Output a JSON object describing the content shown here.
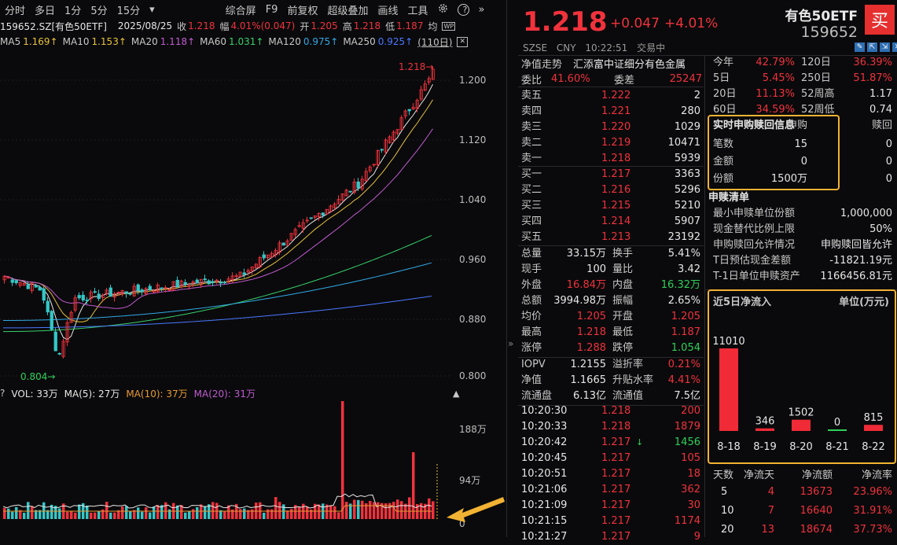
{
  "toolbar": {
    "tabs": [
      "分时",
      "多日",
      "1分",
      "5分",
      "15分"
    ],
    "dropdown_icon": "▾",
    "right": [
      "综合屏",
      "F9",
      "前复权",
      "超级叠加",
      "画线",
      "工具"
    ],
    "settings_icon": "gear-icon",
    "help_icon": "?",
    "more_icon": "»"
  },
  "info": {
    "code": "159652.SZ[有色50ETF]",
    "date": "2025/08/25",
    "close_label": "收",
    "close": "1.218",
    "range_label": "幅",
    "range": "4.01%(0.047)",
    "open_label": "开",
    "open": "1.205",
    "high_label": "高",
    "high": "1.218",
    "low_label": "低",
    "low": "1.187",
    "avg_label": "均"
  },
  "ma": {
    "ma5": "MA5",
    "ma5_v": "1.169↑",
    "ma10": "MA10",
    "ma10_v": "1.153↑",
    "ma20": "MA20",
    "ma20_v": "1.118↑",
    "ma60": "MA60",
    "ma60_v": "1.031↑",
    "ma120": "MA120",
    "ma120_v": "0.975↑",
    "ma250": "MA250",
    "ma250_v": "0.925↑",
    "period": "(110日)"
  },
  "chart": {
    "yticks": [
      "1.200",
      "1.120",
      "1.040",
      "0.960",
      "0.880",
      "0.800"
    ],
    "high_mark": "1.218→",
    "low_mark": "0.804→"
  },
  "vol": {
    "q": "?",
    "vol": "VOL: 33万",
    "ma5": "MA(5): 27万",
    "ma10": "MA(10): 37万",
    "ma20": "MA(20): 31万",
    "yticks": [
      "188万",
      "94万",
      "0"
    ]
  },
  "quote": {
    "price": "1.218",
    "change": "+0.047",
    "pct": "+4.01%",
    "name": "有色50ETF",
    "code": "159652",
    "buy": "买",
    "exch": "SZSE",
    "cur": "CNY",
    "time": "10:22:51",
    "status": "交易中"
  },
  "nav": {
    "label": "净值走势",
    "text": "汇添富中证细分有色金属"
  },
  "wb": {
    "l1": "委比",
    "v1": "41.60%",
    "l2": "委差",
    "v2": "25247"
  },
  "asks": [
    {
      "l": "卖五",
      "p": "1.222",
      "v": "2"
    },
    {
      "l": "卖四",
      "p": "1.221",
      "v": "280"
    },
    {
      "l": "卖三",
      "p": "1.220",
      "v": "1029"
    },
    {
      "l": "卖二",
      "p": "1.219",
      "v": "10471"
    },
    {
      "l": "卖一",
      "p": "1.218",
      "v": "5939"
    }
  ],
  "bids": [
    {
      "l": "买一",
      "p": "1.217",
      "v": "3363"
    },
    {
      "l": "买二",
      "p": "1.216",
      "v": "5296"
    },
    {
      "l": "买三",
      "p": "1.215",
      "v": "5210"
    },
    {
      "l": "买四",
      "p": "1.214",
      "v": "5907"
    },
    {
      "l": "买五",
      "p": "1.213",
      "v": "23192"
    }
  ],
  "stats": [
    [
      "总量",
      "33.15万",
      "换手",
      "5.41%"
    ],
    [
      "现手",
      "100",
      "量比",
      "3.42"
    ],
    [
      "外盘",
      "16.84万",
      "内盘",
      "16.32万"
    ],
    [
      "总额",
      "3994.98万",
      "振幅",
      "2.65%"
    ],
    [
      "均价",
      "1.205",
      "开盘",
      "1.205"
    ],
    [
      "最高",
      "1.218",
      "最低",
      "1.187"
    ],
    [
      "涨停",
      "1.288",
      "跌停",
      "1.054"
    ]
  ],
  "iopv": [
    [
      "IOPV",
      "1.2155",
      "溢折率",
      "0.21%"
    ],
    [
      "净值",
      "1.1665",
      "升贴水率",
      "4.41%"
    ],
    [
      "流通盘",
      "6.13亿",
      "流通值",
      "7.5亿"
    ]
  ],
  "ticks": [
    [
      "10:20:30",
      "1.218",
      "200"
    ],
    [
      "10:20:33",
      "1.218",
      "1879"
    ],
    [
      "10:20:42",
      "1.217",
      "1456"
    ],
    [
      "10:20:45",
      "1.217",
      "105"
    ],
    [
      "10:20:51",
      "1.217",
      "18"
    ],
    [
      "10:21:06",
      "1.217",
      "362"
    ],
    [
      "10:21:09",
      "1.217",
      "30"
    ],
    [
      "10:21:15",
      "1.217",
      "1174"
    ],
    [
      "10:21:27",
      "1.217",
      "9"
    ]
  ],
  "perf": [
    [
      "今年",
      "42.79%",
      "120日",
      "36.39%"
    ],
    [
      "5日",
      "5.45%",
      "250日",
      "51.87%"
    ],
    [
      "20日",
      "11.13%",
      "52周高",
      "1.17"
    ],
    [
      "60日",
      "34.59%",
      "52周低",
      "0.74"
    ]
  ],
  "sub": {
    "title": "实时申购赎回信息",
    "h1": "申购",
    "h2": "赎回",
    "rows": [
      [
        "笔数",
        "15",
        "0"
      ],
      [
        "金额",
        "0",
        "0"
      ],
      [
        "份额",
        "1500万",
        "0"
      ]
    ]
  },
  "creation": {
    "title": "申赎清单",
    "rows": [
      [
        "最小申赎单位份额",
        "1,000,000"
      ],
      [
        "现金替代比例上限",
        "50%"
      ],
      [
        "申购赎回允许情况",
        "申购赎回皆允许"
      ],
      [
        "T日预估现金差额",
        "-11821.19元"
      ],
      [
        "T-1日单位申赎资产",
        "1166456.81元"
      ]
    ]
  },
  "flow": {
    "title": "近5日净流入",
    "unit": "单位(万元)"
  },
  "chart_data": {
    "type": "bar",
    "categories": [
      "8-18",
      "8-19",
      "8-20",
      "8-21",
      "8-22"
    ],
    "values": [
      11010,
      346,
      1502,
      0,
      815
    ],
    "title": "近5日净流入",
    "ylabel": "单位(万元)"
  },
  "netflow": {
    "headers": [
      "天数",
      "净流天",
      "净流额",
      "净流率"
    ],
    "rows": [
      [
        "5",
        "4",
        "13673",
        "23.96%"
      ],
      [
        "10",
        "7",
        "16640",
        "31.91%"
      ],
      [
        "20",
        "13",
        "18674",
        "37.73%"
      ]
    ]
  },
  "colors": {
    "up": "#f0323c",
    "down": "#2fd05a",
    "accent": "#f2b233"
  }
}
